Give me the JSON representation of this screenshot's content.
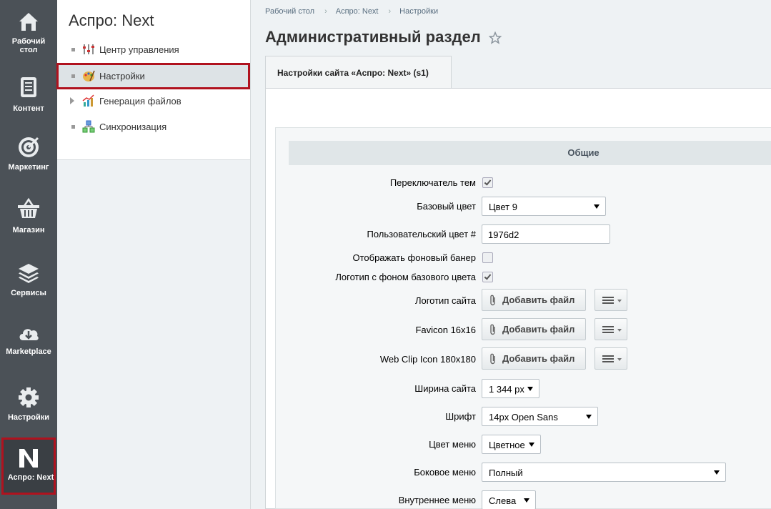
{
  "rail": {
    "items": [
      {
        "label1": "Рабочий",
        "label2": "стол",
        "icon": "home-icon"
      },
      {
        "label1": "Контент",
        "label2": "",
        "icon": "document-icon"
      },
      {
        "label1": "Маркетинг",
        "label2": "",
        "icon": "target-icon"
      },
      {
        "label1": "Магазин",
        "label2": "",
        "icon": "basket-icon"
      },
      {
        "label1": "Сервисы",
        "label2": "",
        "icon": "layers-icon"
      },
      {
        "label1": "Marketplace",
        "label2": "",
        "icon": "cloud-download-icon"
      },
      {
        "label1": "Настройки",
        "label2": "",
        "icon": "gear-icon"
      },
      {
        "label1": "Аспро: Next",
        "label2": "",
        "icon": "aspro-next-logo-icon"
      }
    ]
  },
  "menu": {
    "title": "Аспро: Next",
    "items": [
      {
        "label": "Центр управления",
        "icon": "control-center-icon"
      },
      {
        "label": "Настройки",
        "icon": "palette-icon"
      },
      {
        "label": "Генерация файлов",
        "icon": "file-generation-icon"
      },
      {
        "label": "Синхронизация",
        "icon": "sync-icon"
      }
    ]
  },
  "breadcrumbs": [
    "Рабочий стол",
    "Аспро: Next",
    "Настройки"
  ],
  "page": {
    "title": "Административный раздел",
    "tab": "Настройки сайта «Аспро: Next» (s1)",
    "section": "Общие"
  },
  "form": {
    "theme_switch_label": "Переключатель тем",
    "base_color_label": "Базовый цвет",
    "base_color_value": "Цвет 9",
    "custom_color_label": "Пользовательский цвет #",
    "custom_color_value": "1976d2",
    "bg_banner_label": "Отображать фоновый банер",
    "logo_bg_label": "Логотип с фоном базового цвета",
    "logo_label": "Логотип сайта",
    "favicon_label": "Favicon 16x16",
    "webclip_label": "Web Clip Icon 180x180",
    "add_file": "Добавить файл",
    "width_label": "Ширина сайта",
    "width_value": "1 344 px",
    "font_label": "Шрифт",
    "font_value": "14px Open Sans",
    "menu_color_label": "Цвет меню",
    "menu_color_value": "Цветное",
    "side_menu_label": "Боковое меню",
    "side_menu_value": "Полный",
    "inner_menu_label": "Внутреннее меню",
    "inner_menu_value": "Слева"
  },
  "colors": {
    "rail_bg": "#4b5157",
    "highlight": "#b0121e",
    "accent": "#1976d2"
  }
}
